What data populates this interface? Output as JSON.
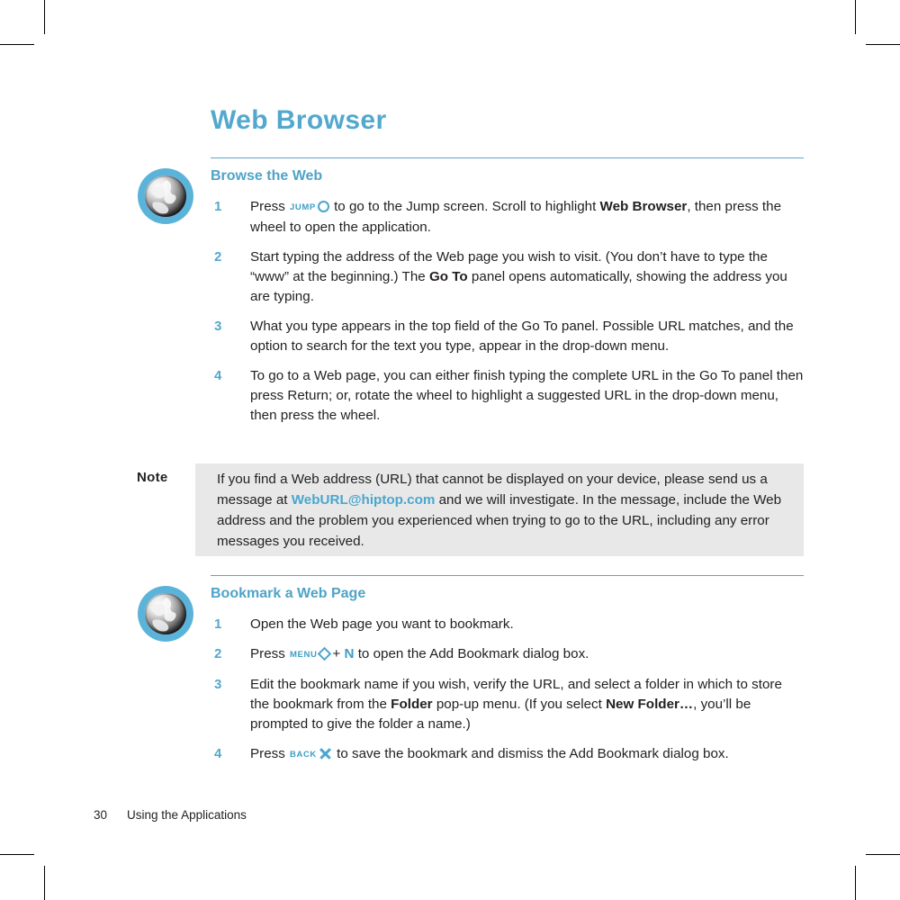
{
  "page": {
    "chapter_title": "Web Browser",
    "footer": {
      "page_number": "30",
      "running_head": "Using the Applications"
    }
  },
  "colors": {
    "accent_blue": "#52a8cd",
    "link_blue": "#4aa6cd",
    "note_background": "#e8e8e8",
    "body_text": "#231f20"
  },
  "sections": [
    {
      "icon": "globe-icon",
      "heading": "Browse the Web",
      "steps": [
        {
          "number": "1",
          "parts": [
            {
              "t": "text",
              "v": "Press "
            },
            {
              "t": "keylabel",
              "v": "JUMP"
            },
            {
              "t": "glyph",
              "v": "circle"
            },
            {
              "t": "text",
              "v": " to go to the Jump screen. Scroll to highlight "
            },
            {
              "t": "bold",
              "v": "Web Browser"
            },
            {
              "t": "text",
              "v": ", then press the wheel to open the application."
            }
          ]
        },
        {
          "number": "2",
          "parts": [
            {
              "t": "text",
              "v": "Start typing the address of the Web page you wish to visit.  (You don’t have to type the “www” at the beginning.) The "
            },
            {
              "t": "bold",
              "v": "Go To"
            },
            {
              "t": "text",
              "v": " panel opens automatically, showing the address you are typing."
            }
          ]
        },
        {
          "number": "3",
          "parts": [
            {
              "t": "text",
              "v": "What you type appears in the top field of the Go To panel. Possible URL matches, and the option to search for the text you type, appear in the drop-down menu."
            }
          ]
        },
        {
          "number": "4",
          "parts": [
            {
              "t": "text",
              "v": "To go to a Web page, you can either finish typing the complete URL in the Go To panel then press Return; or, rotate the wheel to highlight a suggested URL in the drop-down menu, then press the wheel."
            }
          ]
        }
      ]
    },
    {
      "icon": "globe-icon",
      "heading": "Bookmark a Web Page",
      "steps": [
        {
          "number": "1",
          "parts": [
            {
              "t": "text",
              "v": "Open the Web page you want to bookmark."
            }
          ]
        },
        {
          "number": "2",
          "parts": [
            {
              "t": "text",
              "v": "Press "
            },
            {
              "t": "keylabel",
              "v": "MENU"
            },
            {
              "t": "glyph",
              "v": "diamond"
            },
            {
              "t": "text",
              "v": "+ "
            },
            {
              "t": "keychar",
              "v": "N"
            },
            {
              "t": "text",
              "v": " to open the Add Bookmark dialog box."
            }
          ]
        },
        {
          "number": "3",
          "parts": [
            {
              "t": "text",
              "v": "Edit the bookmark name if you wish, verify the URL, and select a folder in which to store the bookmark from the "
            },
            {
              "t": "bold",
              "v": "Folder"
            },
            {
              "t": "text",
              "v": " pop-up menu. (If you select "
            },
            {
              "t": "bold",
              "v": "New Folder…"
            },
            {
              "t": "text",
              "v": ", you’ll be prompted to give the folder a name.)"
            }
          ]
        },
        {
          "number": "4",
          "parts": [
            {
              "t": "text",
              "v": "Press "
            },
            {
              "t": "keylabel",
              "v": "BACK"
            },
            {
              "t": "glyph",
              "v": "x"
            },
            {
              "t": "text",
              "v": " to save the bookmark and dismiss the Add Bookmark dialog box."
            }
          ]
        }
      ]
    }
  ],
  "note": {
    "label": "Note",
    "parts": [
      {
        "t": "text",
        "v": "If you find a Web address (URL) that cannot be displayed on your device, please send us a message at "
      },
      {
        "t": "link",
        "v": "WebURL@hiptop.com"
      },
      {
        "t": "text",
        "v": " and we will investigate. In the message, include the Web address and the problem you experienced when trying to go to the URL, including any error messages you received."
      }
    ]
  }
}
